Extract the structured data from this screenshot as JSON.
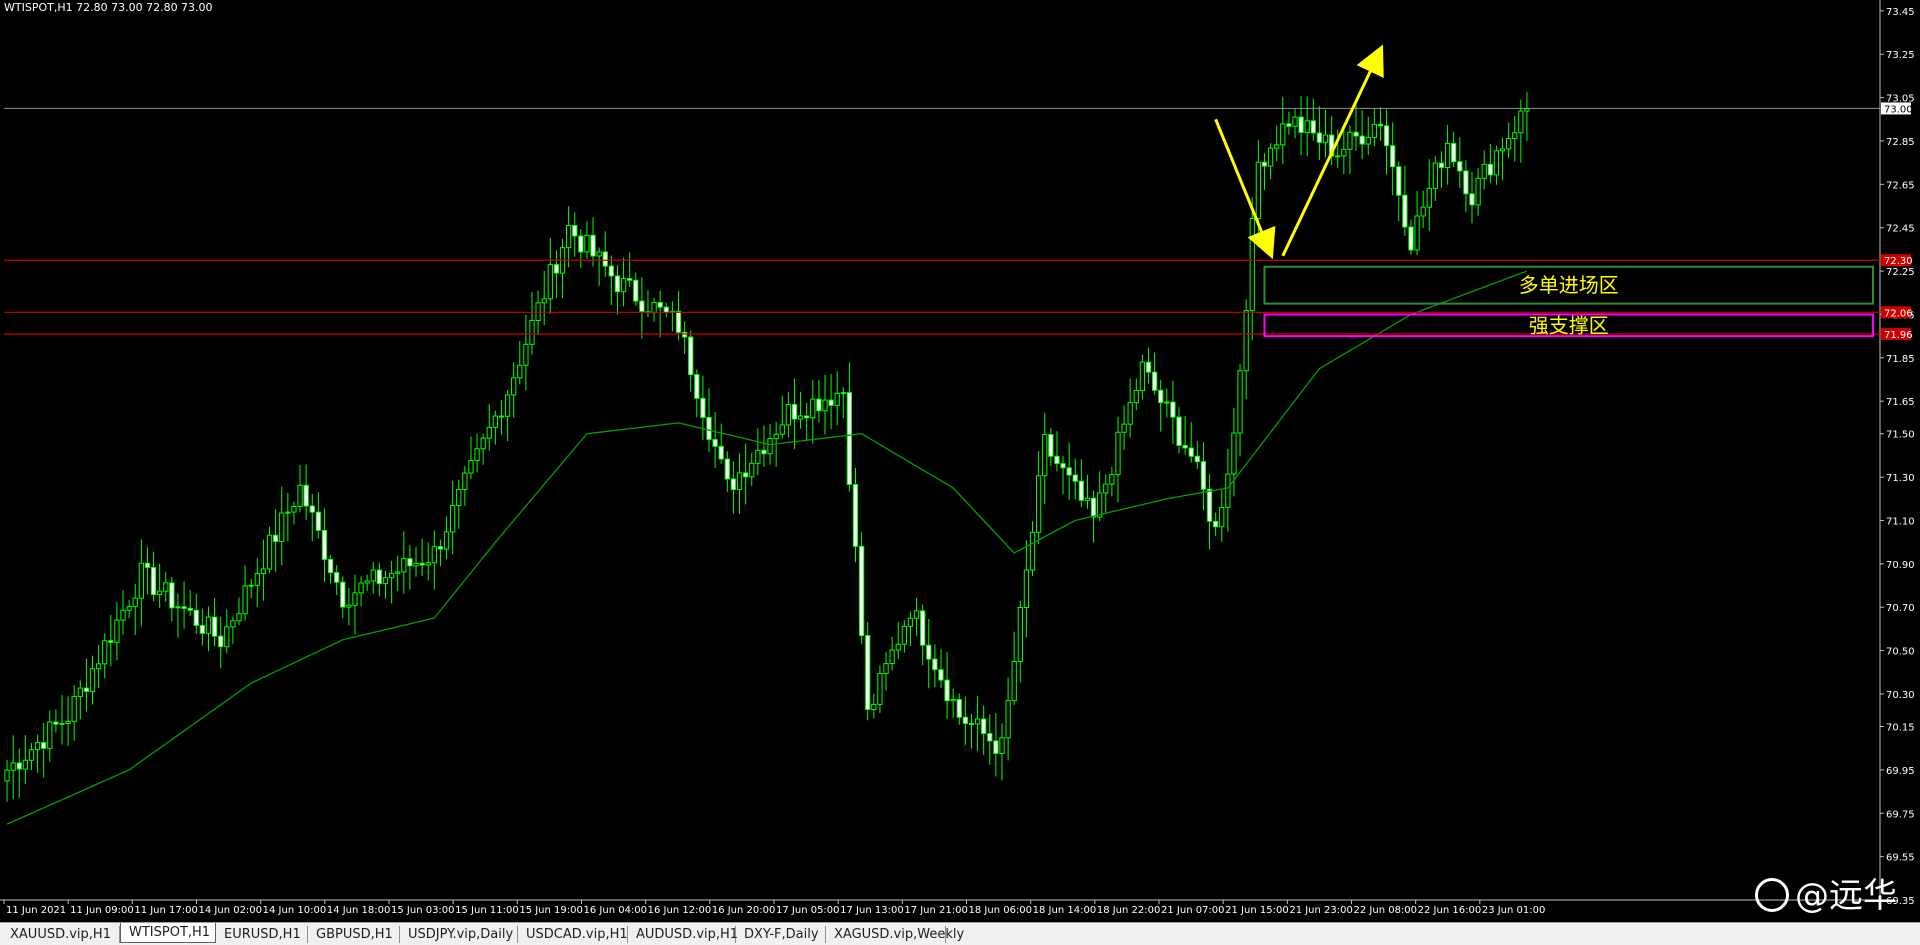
{
  "window": {
    "symbol_title": "WTISPOT,H1  72.80 73.00 72.80 73.00"
  },
  "colors": {
    "background": "#000000",
    "candle_up_body": "#000000",
    "candle_outline": "#00ff00",
    "candle_down_body": "#ffffff",
    "moving_average": "#00a000",
    "resistance_lines": "#d00000",
    "long_entry_box": "#2e8b2e",
    "support_box": "#ff00ff",
    "arrows": "#ffff00",
    "label_text": "#ffff00"
  },
  "chart_data": {
    "type": "candlestick",
    "symbol": "WTISPOT",
    "timeframe": "H1",
    "ylim": [
      69.35,
      73.5
    ],
    "y_ticks": [
      "73.45",
      "73.25",
      "73.05",
      "72.85",
      "72.65",
      "72.45",
      "72.25",
      "72.05",
      "71.85",
      "71.65",
      "71.50",
      "71.30",
      "71.10",
      "70.90",
      "70.70",
      "70.50",
      "70.30",
      "70.15",
      "69.95",
      "69.75",
      "69.55",
      "69.35"
    ],
    "x_ticks": [
      "11 Jun 2021",
      "11 Jun 09:00",
      "11 Jun 17:00",
      "14 Jun 02:00",
      "14 Jun 10:00",
      "14 Jun 18:00",
      "15 Jun 03:00",
      "15 Jun 11:00",
      "15 Jun 19:00",
      "16 Jun 04:00",
      "16 Jun 12:00",
      "16 Jun 20:00",
      "17 Jun 05:00",
      "17 Jun 13:00",
      "17 Jun 21:00",
      "18 Jun 06:00",
      "18 Jun 14:00",
      "18 Jun 22:00",
      "21 Jun 07:00",
      "21 Jun 15:00",
      "21 Jun 23:00",
      "22 Jun 08:00",
      "22 Jun 16:00",
      "23 Jun 01:00"
    ],
    "current_price": "73.00",
    "horizontal_lines": [
      {
        "price": 72.3,
        "label": "72.30"
      },
      {
        "price": 72.06,
        "label": "72.06"
      },
      {
        "price": 71.96,
        "label": "71.96"
      }
    ],
    "zones": [
      {
        "name": "多单进场区",
        "top": 72.27,
        "bottom": 72.1,
        "color": "#2e8b2e"
      },
      {
        "name": "强支撑区",
        "top": 72.05,
        "bottom": 71.95,
        "color": "#ff00ff"
      }
    ],
    "arrows": [
      {
        "from": [
          72.95,
          198
        ],
        "to": [
          72.33,
          207
        ],
        "note": "down"
      },
      {
        "from": [
          72.32,
          209
        ],
        "to": [
          73.27,
          225
        ],
        "note": "up"
      }
    ],
    "anchor_points": [
      {
        "bar": 0,
        "close": 69.95
      },
      {
        "bar": 10,
        "close": 70.2
      },
      {
        "bar": 22,
        "close": 70.85
      },
      {
        "bar": 35,
        "close": 70.55
      },
      {
        "bar": 48,
        "close": 71.25
      },
      {
        "bar": 55,
        "close": 70.75
      },
      {
        "bar": 70,
        "close": 70.95
      },
      {
        "bar": 82,
        "close": 71.7
      },
      {
        "bar": 92,
        "close": 72.45
      },
      {
        "bar": 100,
        "close": 72.2
      },
      {
        "bar": 110,
        "close": 72.0
      },
      {
        "bar": 118,
        "close": 71.25
      },
      {
        "bar": 128,
        "close": 71.6
      },
      {
        "bar": 137,
        "close": 71.7
      },
      {
        "bar": 141,
        "close": 70.2
      },
      {
        "bar": 148,
        "close": 70.7
      },
      {
        "bar": 156,
        "close": 70.2
      },
      {
        "bar": 163,
        "close": 70.05
      },
      {
        "bar": 170,
        "close": 71.45
      },
      {
        "bar": 178,
        "close": 71.1
      },
      {
        "bar": 186,
        "close": 71.8
      },
      {
        "bar": 194,
        "close": 71.4
      },
      {
        "bar": 198,
        "close": 71.05
      },
      {
        "bar": 201,
        "close": 71.5
      },
      {
        "bar": 205,
        "close": 72.75
      },
      {
        "bar": 210,
        "close": 72.95
      },
      {
        "bar": 218,
        "close": 72.8
      },
      {
        "bar": 225,
        "close": 72.95
      },
      {
        "bar": 230,
        "close": 72.4
      },
      {
        "bar": 236,
        "close": 72.85
      },
      {
        "bar": 240,
        "close": 72.6
      },
      {
        "bar": 244,
        "close": 72.8
      },
      {
        "bar": 249,
        "close": 73.0
      }
    ],
    "ma_points": [
      {
        "bar": 0,
        "value": 69.7
      },
      {
        "bar": 20,
        "value": 69.95
      },
      {
        "bar": 40,
        "value": 70.35
      },
      {
        "bar": 55,
        "value": 70.55
      },
      {
        "bar": 70,
        "value": 70.65
      },
      {
        "bar": 80,
        "value": 71.0
      },
      {
        "bar": 95,
        "value": 71.5
      },
      {
        "bar": 110,
        "value": 71.55
      },
      {
        "bar": 125,
        "value": 71.45
      },
      {
        "bar": 140,
        "value": 71.5
      },
      {
        "bar": 155,
        "value": 71.25
      },
      {
        "bar": 165,
        "value": 70.95
      },
      {
        "bar": 175,
        "value": 71.1
      },
      {
        "bar": 190,
        "value": 71.2
      },
      {
        "bar": 200,
        "value": 71.25
      },
      {
        "bar": 215,
        "value": 71.8
      },
      {
        "bar": 230,
        "value": 72.05
      },
      {
        "bar": 249,
        "value": 72.25
      }
    ]
  },
  "tabs": [
    {
      "label": "XAUUSD.vip,H1",
      "active": false
    },
    {
      "label": "WTISPOT,H1",
      "active": true
    },
    {
      "label": "EURUSD,H1",
      "active": false
    },
    {
      "label": "GBPUSD,H1",
      "active": false
    },
    {
      "label": "USDJPY.vip,Daily",
      "active": false
    },
    {
      "label": "USDCAD.vip,H1",
      "active": false
    },
    {
      "label": "AUDUSD.vip,H1",
      "active": false
    },
    {
      "label": "DXY-F,Daily",
      "active": false
    },
    {
      "label": "XAGUSD.vip,Weekly",
      "active": false
    }
  ],
  "watermark": {
    "text": "@远华"
  }
}
